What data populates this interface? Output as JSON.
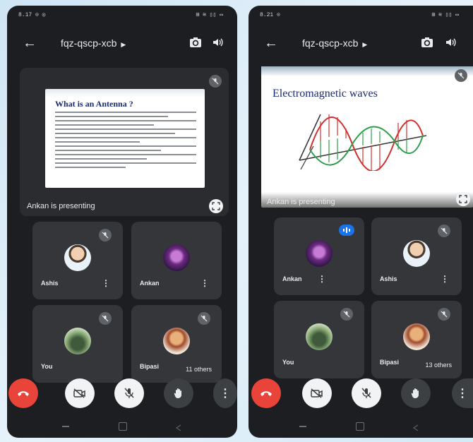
{
  "left": {
    "status_time": "8.17",
    "status_icons": "⊙ ◎",
    "status_right": "⊞ ≋ ▯▯ ▭",
    "meeting_code": "fqz-qscp-xcb",
    "slide_title": "What is an Antenna ?",
    "presenting": "Ankan is presenting",
    "tiles": [
      {
        "name": "Ashis"
      },
      {
        "name": "Ankan"
      },
      {
        "name": "You"
      },
      {
        "name": "Bipasi",
        "others": "11 others"
      }
    ]
  },
  "right": {
    "status_time": "8.21",
    "status_icons": "⊙",
    "status_right": "⊞ ≋ ▯▯ ▭",
    "meeting_code": "fqz-qscp-xcb",
    "slide_title": "Electromagnetic waves",
    "presenting": "Ankan is presenting",
    "tiles": [
      {
        "name": "Ankan"
      },
      {
        "name": "Ashis"
      },
      {
        "name": "You"
      },
      {
        "name": "Bipasi",
        "others": "13 others"
      }
    ]
  },
  "icons": {
    "back": "back-arrow-icon",
    "switch_camera": "switch-camera-icon",
    "speaker": "speaker-icon",
    "mic_off": "mic-off-icon",
    "fullscreen": "fullscreen-icon",
    "end_call": "end-call-icon",
    "camera_off": "camera-off-icon",
    "hand": "raise-hand-icon",
    "more": "more-vert-icon"
  },
  "colors": {
    "end_call": "#e8443a",
    "speaking": "#1a73e8",
    "background": "#1d1e22",
    "tile": "#35363a"
  }
}
